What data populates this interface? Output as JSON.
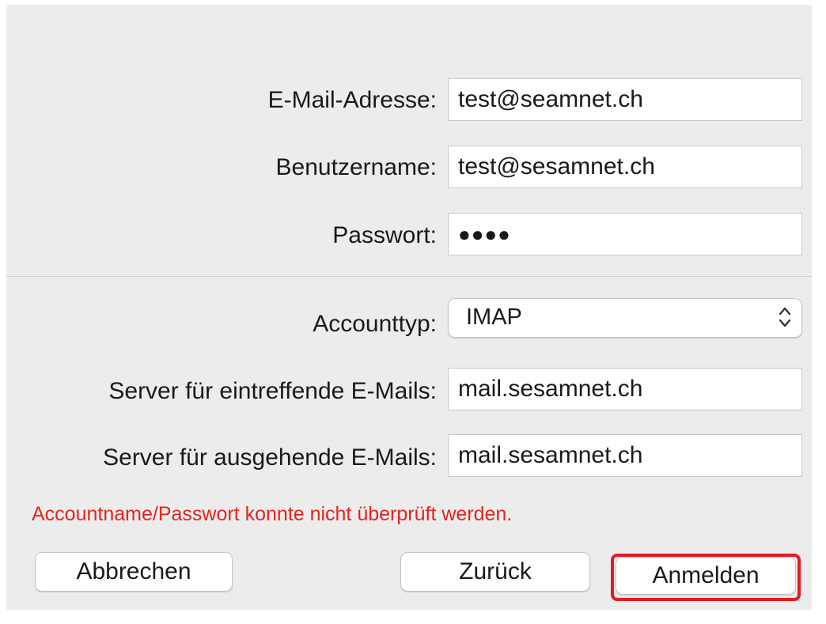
{
  "form": {
    "email": {
      "label": "E-Mail-Adresse:",
      "value": "test@seamnet.ch"
    },
    "username": {
      "label": "Benutzername:",
      "value": "test@sesamnet.ch"
    },
    "password": {
      "label": "Passwort:",
      "value": "●●●●"
    },
    "account_type": {
      "label": "Accounttyp:",
      "value": "IMAP"
    },
    "incoming_server": {
      "label": "Server für eintreffende E-Mails:",
      "value": "mail.sesamnet.ch"
    },
    "outgoing_server": {
      "label": "Server für ausgehende E-Mails:",
      "value": "mail.sesamnet.ch"
    }
  },
  "error_message": "Accountname/Passwort konnte nicht überprüft werden.",
  "buttons": {
    "cancel": "Abbrechen",
    "back": "Zurück",
    "sign_in": "Anmelden"
  },
  "colors": {
    "error": "#e0261f",
    "highlight": "#e31b23",
    "panel_background": "#ececec"
  },
  "icons": {
    "select_arrows": "chevron-up-down-icon"
  }
}
